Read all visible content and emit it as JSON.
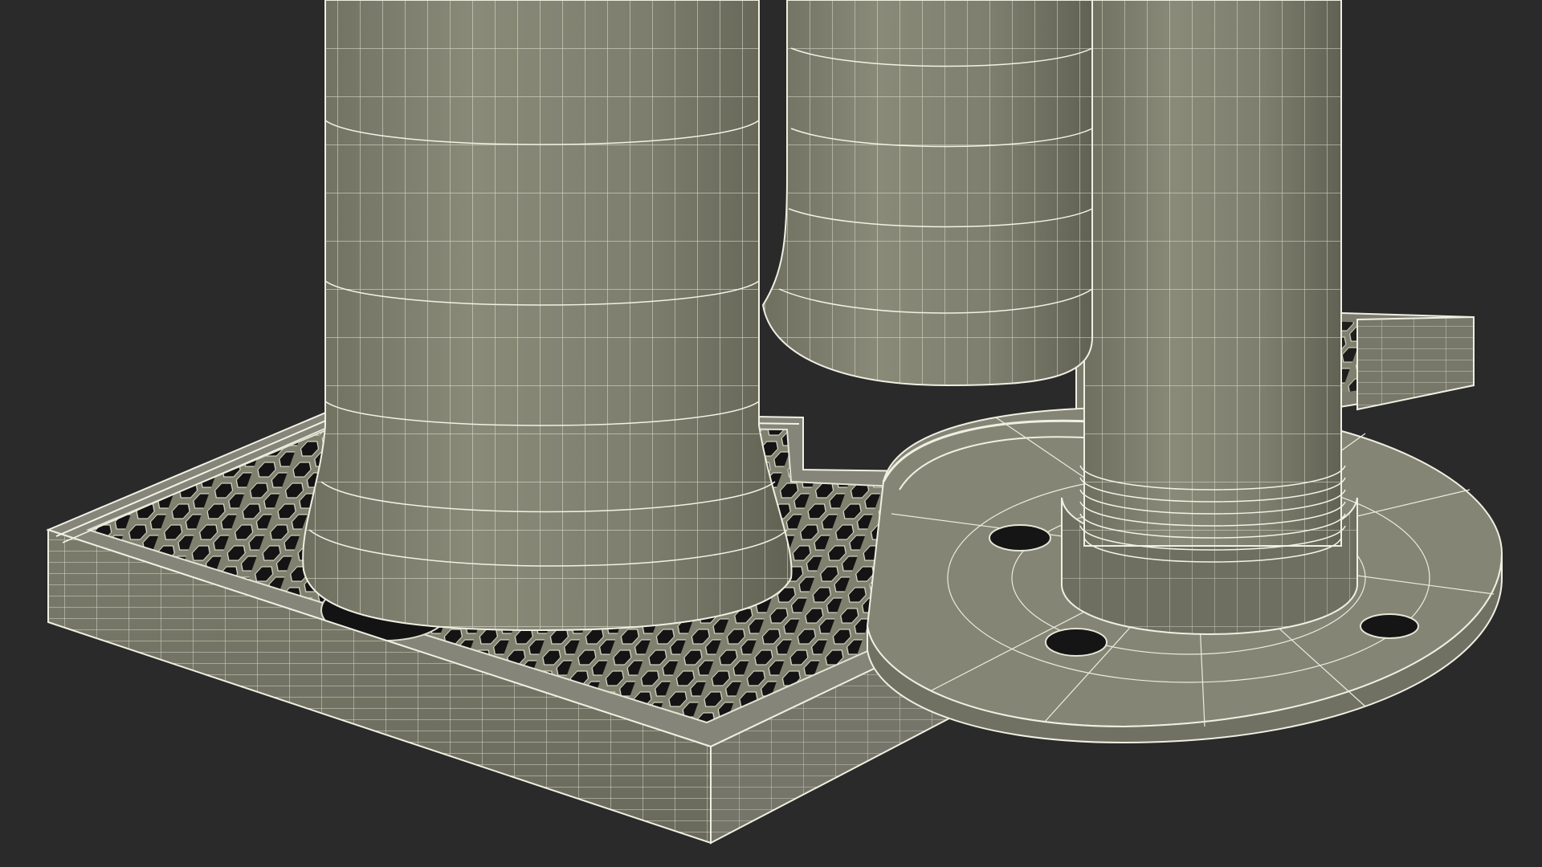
{
  "scene": {
    "subject": "beer-tap-drip-tray-wireframe-render",
    "colors": {
      "background": "#2a2a2a",
      "surface": "#858574",
      "surface_dark": "#6b6b5c",
      "surface_light": "#97978a",
      "wire": "#efefe2",
      "hole": "#141414"
    }
  }
}
